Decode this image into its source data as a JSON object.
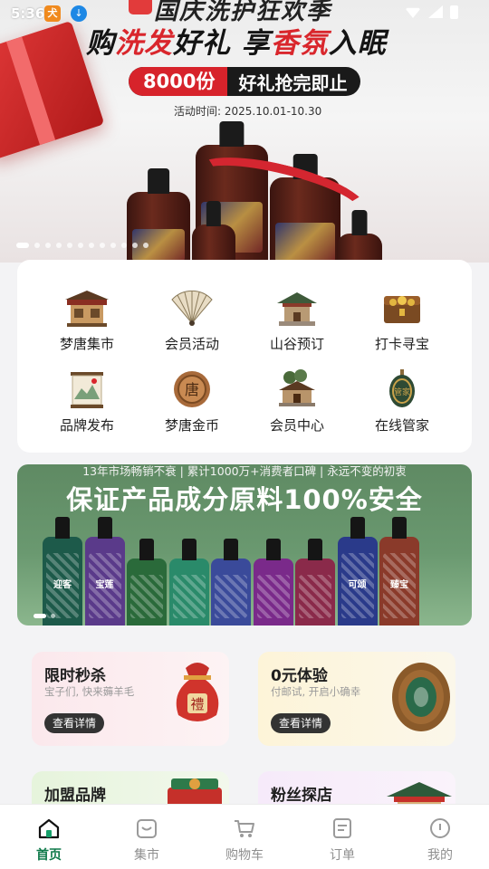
{
  "status_bar": {
    "time": "5:36"
  },
  "hero": {
    "title_top": "国庆洗护狂欢季",
    "title_part1": "购",
    "title_red1": "洗发",
    "title_part2": "好礼 享",
    "title_red2": "香氛",
    "title_part3": "入眠",
    "pill_count": "8000份",
    "pill_text": "好礼抢完即止",
    "date_text": "活动时间: 2025.10.01-10.30",
    "slide_count": 12,
    "active_slide": 0
  },
  "menu": {
    "items": [
      {
        "label": "梦唐集市",
        "icon": "market-stall-icon"
      },
      {
        "label": "会员活动",
        "icon": "folding-fan-icon"
      },
      {
        "label": "山谷预订",
        "icon": "pavilion-icon"
      },
      {
        "label": "打卡寻宝",
        "icon": "treasure-chest-icon"
      },
      {
        "label": "品牌发布",
        "icon": "scroll-painting-icon"
      },
      {
        "label": "梦唐金币",
        "icon": "tang-coin-icon"
      },
      {
        "label": "会员中心",
        "icon": "pagoda-tree-icon"
      },
      {
        "label": "在线管家",
        "icon": "jade-pendant-icon"
      }
    ]
  },
  "promo": {
    "subtitle": "13年市场畅销不衰 | 累计1000万+消费者口碑 | 永远不变的初衷",
    "title": "保证产品成分原料100%安全",
    "bottles": [
      {
        "name": "迎客",
        "color": "#1d5a4a"
      },
      {
        "name": "宝莲",
        "color": "#5a3a8a"
      },
      {
        "name": "",
        "color": "#2a6a3a"
      },
      {
        "name": "",
        "color": "#2a8a6a"
      },
      {
        "name": "",
        "color": "#3a4a9a"
      },
      {
        "name": "",
        "color": "#7a2a8a"
      },
      {
        "name": "",
        "color": "#8a2a4a"
      },
      {
        "name": "可颂",
        "color": "#2a3a8a"
      },
      {
        "name": "臻宝",
        "color": "#8a3a2a"
      }
    ]
  },
  "activities": [
    {
      "title": "限时秒杀",
      "subtitle": "宝子们, 快来薅羊毛",
      "button": "查看详情",
      "icon": "fortune-bag-icon",
      "bag_text": "禮"
    },
    {
      "title": "0元体验",
      "subtitle": "付邮试, 开启小确幸",
      "button": "查看详情",
      "icon": "jade-ring-icon"
    },
    {
      "title": "加盟品牌",
      "icon": "gift-basket-icon"
    },
    {
      "title": "粉丝探店",
      "icon": "shop-roof-icon"
    }
  ],
  "tabbar": {
    "items": [
      {
        "label": "首页",
        "icon": "home-icon"
      },
      {
        "label": "集市",
        "icon": "market-icon"
      },
      {
        "label": "购物车",
        "icon": "cart-icon"
      },
      {
        "label": "订单",
        "icon": "order-icon"
      },
      {
        "label": "我的",
        "icon": "profile-icon"
      }
    ],
    "active_index": 0
  }
}
